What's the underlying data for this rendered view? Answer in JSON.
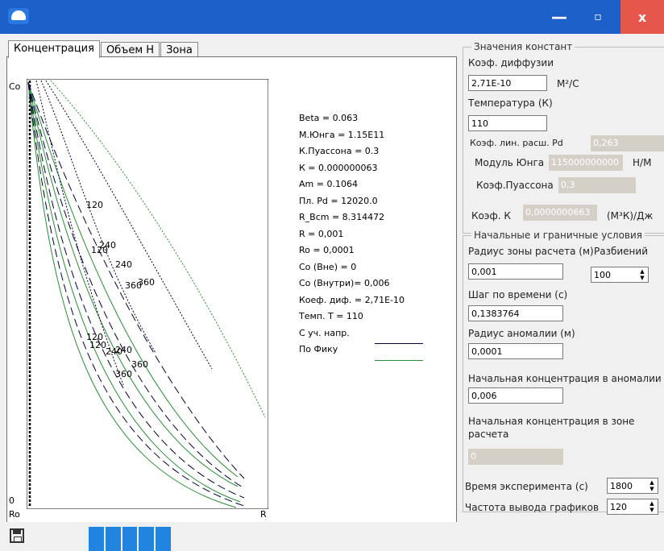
{
  "window": {
    "minimize": "—",
    "maximize": "▫",
    "close": "x"
  },
  "tabs": [
    "Концентрация",
    "Объем Н",
    "Зона"
  ],
  "plot": {
    "y_top": "Co",
    "y_bottom": "0",
    "x_left": "Ro",
    "x_right": "R",
    "curve_labels": [
      "120",
      "240",
      "120",
      "240",
      "360",
      "360",
      "120",
      "120",
      "240",
      "240",
      "360",
      "360"
    ]
  },
  "params": [
    "Beta      = 0.063",
    "М.Юнга     = 1.15E11",
    "К.Пуассона = 0.3",
    "К        = 0.000000063",
    "Am       = 0.1064",
    "Пл. Pd    = 12020.0",
    "R_Bcm     = 8.314472",
    "R        = 0,001",
    "Ro       = 0,0001",
    "Co (Вне)   = 0",
    "Co (Внутри)= 0,006",
    "Коеф. диф. = 2,71E-10",
    "Темп. T    = 110"
  ],
  "legend": {
    "stress": "С уч. напр.",
    "fick": "По Фику",
    "stress_color": "#000033",
    "fick_color": "#2e8b3a"
  },
  "constants": {
    "title": "Значения констант",
    "diff_label": "Коэф. диффузии",
    "diff_value": "2,71E-10",
    "diff_unit": "М²/С",
    "temp_label": "Температура (К)",
    "temp_value": "110",
    "lin_label": "Коэф. лин. расш. Pd",
    "lin_value": "0,263",
    "young_label": "Модуль Юнга",
    "young_value": "115000000000",
    "young_unit": "Н/М",
    "poisson_label": "Коэф.Пуассона",
    "poisson_value": "0,3",
    "k_label": "Коэф. К",
    "k_value": "0,0000000663",
    "k_unit": "(М³К)/Дж"
  },
  "conditions": {
    "title": "Начальные и граничные условия",
    "radius_label": "Радиус зоны расчета (м)",
    "radius_value": "0,001",
    "parts_label": "Разбиений",
    "parts_value": "100",
    "step_label": "Шаг по времени (с)",
    "step_value": "0,1383764",
    "anom_label": "Радиус аномалии (м)",
    "anom_value": "0,0001",
    "init_anom_label": "Начальная концентрация в аномалии",
    "init_anom_value": "0,006",
    "init_zone_label": "Начальная концентрация в зоне расчета",
    "init_zone_value": "0",
    "time_label": "Время эксперимента (с)",
    "time_value": "1800",
    "freq_label": "Частота вывода графиков",
    "freq_value": "120"
  },
  "progress_blocks": 5
}
